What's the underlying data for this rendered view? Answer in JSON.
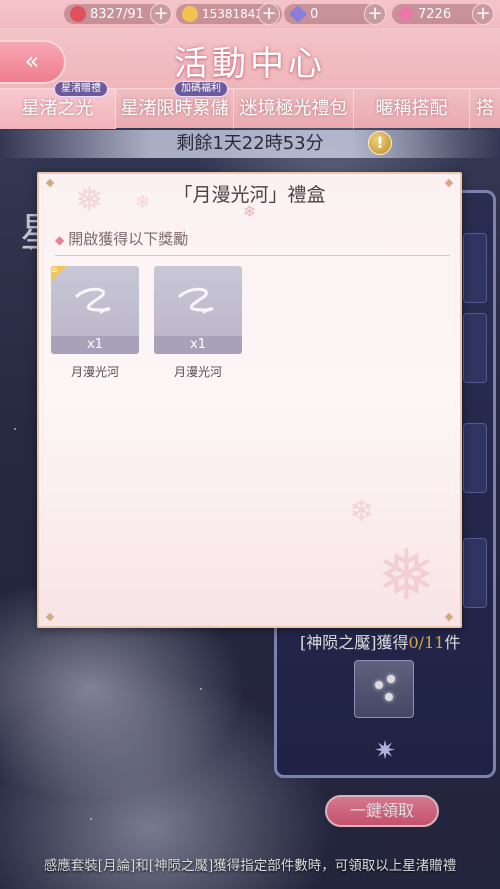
{
  "resources": {
    "stamina": "8327/91",
    "gold": "15381842",
    "diamonds": "0",
    "gems": "7226",
    "plus": "+"
  },
  "header": {
    "back": "«",
    "title": "活動中心"
  },
  "tabs": [
    {
      "label": "星渚之光",
      "badge": "星渚贈禮"
    },
    {
      "label": "星渚限時累儲",
      "badge": "加碼福利"
    },
    {
      "label": "迷境極光禮包",
      "badge": ""
    },
    {
      "label": "暱稱搭配",
      "badge": ""
    },
    {
      "label": "搭",
      "badge": ""
    }
  ],
  "countdown": "剩餘1天22時53分",
  "info": "!",
  "side_title": "星",
  "panel": {
    "part_prefix": "[神陨之魘]獲得",
    "part_count": "0/11",
    "part_suffix": "件"
  },
  "claim_button": "一鍵領取",
  "bottom_note": "感應套裝[月論]和[神陨之魘]獲得指定部件數時，可領取以上星渚贈禮",
  "modal": {
    "title": "「月漫光河」禮盒",
    "section_title": "開啟獲得以下獎勵",
    "rewards": [
      {
        "name": "月漫光河",
        "qty": "x1",
        "is_new": true
      },
      {
        "name": "月漫光河",
        "qty": "x1",
        "is_new": false
      }
    ]
  },
  "colors": {
    "accent_pink": "#e55c7a",
    "header_pink": "#f3c4c8",
    "count_gold": "#f2c34e"
  }
}
